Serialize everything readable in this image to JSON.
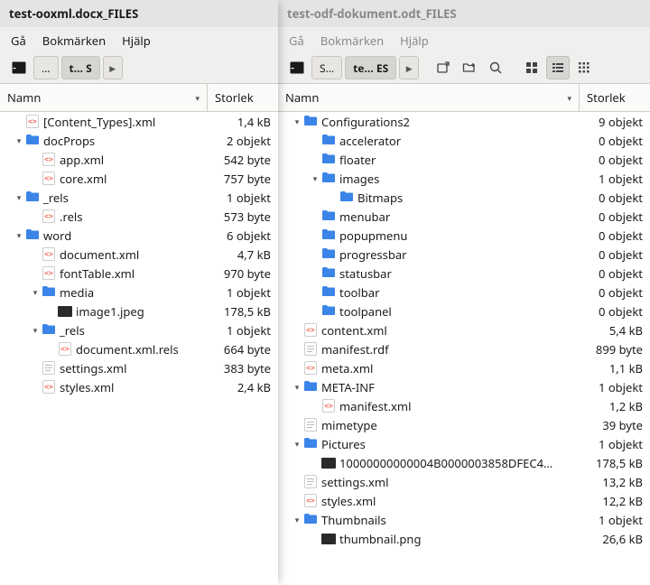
{
  "left": {
    "title": "test-ooxml.docx_FILES",
    "menu": {
      "go": "Gå",
      "bookmarks": "Bokmärken",
      "help": "Hjälp"
    },
    "path": {
      "p0": "…",
      "p1": "t… S"
    },
    "cols": {
      "name": "Namn",
      "size": "Storlek"
    },
    "rows": [
      {
        "d": 0,
        "exp": "",
        "kind": "xml",
        "label": "[Content_Types].xml",
        "size": "1,4 kB"
      },
      {
        "d": 0,
        "exp": "▾",
        "kind": "folder",
        "label": "docProps",
        "size": "2 objekt"
      },
      {
        "d": 1,
        "exp": "",
        "kind": "xml",
        "label": "app.xml",
        "size": "542 byte"
      },
      {
        "d": 1,
        "exp": "",
        "kind": "xml",
        "label": "core.xml",
        "size": "757 byte"
      },
      {
        "d": 0,
        "exp": "▾",
        "kind": "folder",
        "label": "_rels",
        "size": "1 objekt"
      },
      {
        "d": 1,
        "exp": "",
        "kind": "xml",
        "label": ".rels",
        "size": "573 byte"
      },
      {
        "d": 0,
        "exp": "▾",
        "kind": "folder",
        "label": "word",
        "size": "6 objekt"
      },
      {
        "d": 1,
        "exp": "",
        "kind": "xml",
        "label": "document.xml",
        "size": "4,7 kB"
      },
      {
        "d": 1,
        "exp": "",
        "kind": "xml",
        "label": "fontTable.xml",
        "size": "970 byte"
      },
      {
        "d": 1,
        "exp": "▾",
        "kind": "folder",
        "label": "media",
        "size": "1 objekt"
      },
      {
        "d": 2,
        "exp": "",
        "kind": "image",
        "label": "image1.jpeg",
        "size": "178,5 kB"
      },
      {
        "d": 1,
        "exp": "▾",
        "kind": "folder",
        "label": "_rels",
        "size": "1 objekt"
      },
      {
        "d": 2,
        "exp": "",
        "kind": "xml",
        "label": "document.xml.rels",
        "size": "664 byte"
      },
      {
        "d": 1,
        "exp": "",
        "kind": "text",
        "label": "settings.xml",
        "size": "383 byte"
      },
      {
        "d": 1,
        "exp": "",
        "kind": "xml",
        "label": "styles.xml",
        "size": "2,4 kB"
      }
    ]
  },
  "right": {
    "title": "test-odf-dokument.odt_FILES",
    "menu": {
      "go": "Gå",
      "bookmarks": "Bokmärken",
      "help": "Hjälp"
    },
    "path": {
      "p0": "S…",
      "p1": "te… ES"
    },
    "cols": {
      "name": "Namn",
      "size": "Storlek"
    },
    "rows": [
      {
        "d": 0,
        "exp": "▾",
        "kind": "folder",
        "label": "Configurations2",
        "size": "9 objekt"
      },
      {
        "d": 1,
        "exp": "",
        "kind": "folder",
        "label": "accelerator",
        "size": "0 objekt"
      },
      {
        "d": 1,
        "exp": "",
        "kind": "folder",
        "label": "floater",
        "size": "0 objekt"
      },
      {
        "d": 1,
        "exp": "▾",
        "kind": "folder",
        "label": "images",
        "size": "1 objekt"
      },
      {
        "d": 2,
        "exp": "",
        "kind": "folder",
        "label": "Bitmaps",
        "size": "0 objekt"
      },
      {
        "d": 1,
        "exp": "",
        "kind": "folder",
        "label": "menubar",
        "size": "0 objekt"
      },
      {
        "d": 1,
        "exp": "",
        "kind": "folder",
        "label": "popupmenu",
        "size": "0 objekt"
      },
      {
        "d": 1,
        "exp": "",
        "kind": "folder",
        "label": "progressbar",
        "size": "0 objekt"
      },
      {
        "d": 1,
        "exp": "",
        "kind": "folder",
        "label": "statusbar",
        "size": "0 objekt"
      },
      {
        "d": 1,
        "exp": "",
        "kind": "folder",
        "label": "toolbar",
        "size": "0 objekt"
      },
      {
        "d": 1,
        "exp": "",
        "kind": "folder",
        "label": "toolpanel",
        "size": "0 objekt"
      },
      {
        "d": 0,
        "exp": "",
        "kind": "xml",
        "label": "content.xml",
        "size": "5,4 kB"
      },
      {
        "d": 0,
        "exp": "",
        "kind": "text",
        "label": "manifest.rdf",
        "size": "899 byte"
      },
      {
        "d": 0,
        "exp": "",
        "kind": "xml",
        "label": "meta.xml",
        "size": "1,1 kB"
      },
      {
        "d": 0,
        "exp": "▾",
        "kind": "folder",
        "label": "META-INF",
        "size": "1 objekt"
      },
      {
        "d": 1,
        "exp": "",
        "kind": "xml",
        "label": "manifest.xml",
        "size": "1,2 kB"
      },
      {
        "d": 0,
        "exp": "",
        "kind": "text",
        "label": "mimetype",
        "size": "39 byte"
      },
      {
        "d": 0,
        "exp": "▾",
        "kind": "folder",
        "label": "Pictures",
        "size": "1 objekt"
      },
      {
        "d": 1,
        "exp": "",
        "kind": "image",
        "label": "10000000000004B0000003858DFEC4…",
        "size": "178,5 kB"
      },
      {
        "d": 0,
        "exp": "",
        "kind": "text",
        "label": "settings.xml",
        "size": "13,2 kB"
      },
      {
        "d": 0,
        "exp": "",
        "kind": "xml",
        "label": "styles.xml",
        "size": "12,2 kB"
      },
      {
        "d": 0,
        "exp": "▾",
        "kind": "folder",
        "label": "Thumbnails",
        "size": "1 objekt"
      },
      {
        "d": 1,
        "exp": "",
        "kind": "image",
        "label": "thumbnail.png",
        "size": "26,6 kB"
      }
    ]
  }
}
